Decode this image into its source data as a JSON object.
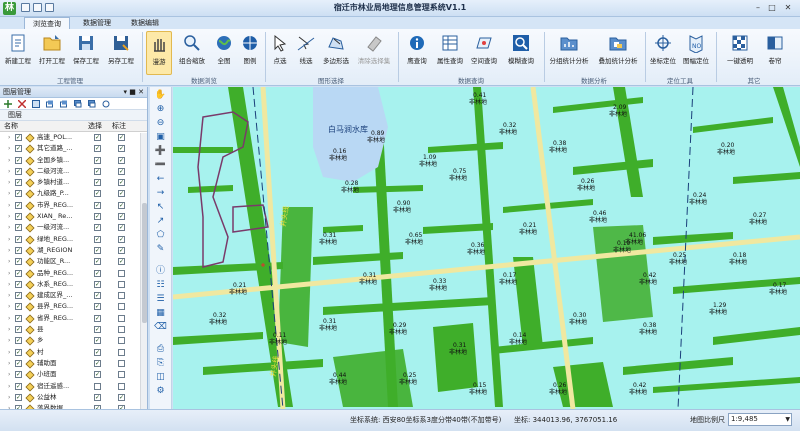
{
  "window": {
    "title": "宿迁市林业局地理信息管理系统V1.1"
  },
  "tabs": [
    {
      "label": "浏览查询",
      "active": true
    },
    {
      "label": "数据管理",
      "active": false
    },
    {
      "label": "数据编辑",
      "active": false
    }
  ],
  "ribbon": {
    "groups": [
      {
        "label": "工程管理",
        "buttons": [
          "新建工程",
          "打开工程",
          "保存工程",
          "另存工程"
        ]
      },
      {
        "label": "数据浏览",
        "buttons": [
          "漫游",
          "组合缩放",
          "全图",
          "图例"
        ]
      },
      {
        "label": "图形选择",
        "buttons": [
          "点选",
          "线选",
          "多边形选",
          "清除选择集"
        ]
      },
      {
        "label": "数据查询",
        "buttons": [
          "鹰查询",
          "属性查询",
          "空间查询",
          "模糊查询"
        ]
      },
      {
        "label": "数据分析",
        "buttons": [
          "分组统计分析",
          "叠加统计分析"
        ]
      },
      {
        "label": "定位工具",
        "buttons": [
          "坐标定位",
          "图幅定位"
        ]
      },
      {
        "label": "其它",
        "buttons": [
          "一键透明",
          "卷帘"
        ]
      }
    ]
  },
  "left_panel": {
    "title": "图层管理",
    "tab": "图层",
    "columns": {
      "name": "名称",
      "select": "选择",
      "label": "标注"
    },
    "layers": [
      {
        "name": "高速_POL...",
        "visible": true,
        "select": true,
        "label": true
      },
      {
        "name": "其它道路_...",
        "visible": true,
        "select": true,
        "label": true
      },
      {
        "name": "全国乡镇...",
        "visible": true,
        "select": true,
        "label": true
      },
      {
        "name": "二级河流...",
        "visible": true,
        "select": true,
        "label": true
      },
      {
        "name": "乡镇村道...",
        "visible": true,
        "select": true,
        "label": true
      },
      {
        "name": "九级路_P...",
        "visible": true,
        "select": true,
        "label": true
      },
      {
        "name": "市界_REG...",
        "visible": true,
        "select": true,
        "label": true
      },
      {
        "name": "XIAN_ Re...",
        "visible": true,
        "select": true,
        "label": true
      },
      {
        "name": "一级河流...",
        "visible": true,
        "select": true,
        "label": true
      },
      {
        "name": "绿地_REG...",
        "visible": true,
        "select": true,
        "label": true
      },
      {
        "name": "湖_REGION",
        "visible": true,
        "select": true,
        "label": true
      },
      {
        "name": "功能区_R...",
        "visible": true,
        "select": true,
        "label": true
      },
      {
        "name": "品种_REG...",
        "visible": true,
        "select": true,
        "label": false
      },
      {
        "name": "水系_REG...",
        "visible": true,
        "select": true,
        "label": false
      },
      {
        "name": "建成区界_...",
        "visible": true,
        "select": true,
        "label": false
      },
      {
        "name": "县界_REG...",
        "visible": true,
        "select": true,
        "label": false
      },
      {
        "name": "省界_REG...",
        "visible": true,
        "select": true,
        "label": false
      },
      {
        "name": "县",
        "visible": true,
        "select": true,
        "label": false
      },
      {
        "name": "乡",
        "visible": true,
        "select": true,
        "label": false
      },
      {
        "name": "村",
        "visible": true,
        "select": true,
        "label": false
      },
      {
        "name": "辅助面",
        "visible": true,
        "select": true,
        "label": false
      },
      {
        "name": "小班面",
        "visible": true,
        "select": true,
        "label": false
      },
      {
        "name": "宿迁遥感...",
        "visible": true,
        "select": false,
        "label": false
      },
      {
        "name": "公益林",
        "visible": true,
        "select": true,
        "label": true
      },
      {
        "name": "落界数据...",
        "visible": true,
        "select": true,
        "label": true
      }
    ]
  },
  "map": {
    "lake_label": "白马涧水库",
    "road_labels": [
      "井头线",
      "井头线"
    ],
    "parcel_labels": [
      {
        "value": "0.89",
        "type": "非林地"
      },
      {
        "value": "0.41",
        "type": "非林地"
      },
      {
        "value": "2.09",
        "type": "非林地"
      },
      {
        "value": "0.16",
        "type": "非林地"
      },
      {
        "value": "0.28",
        "type": "非林地"
      },
      {
        "value": "0.90",
        "type": "非林地"
      },
      {
        "value": "1.09",
        "type": "非林地"
      },
      {
        "value": "0.75",
        "type": "非林地"
      },
      {
        "value": "0.32",
        "type": "非林地"
      },
      {
        "value": "0.38",
        "type": "非林地"
      },
      {
        "value": "0.26",
        "type": "非林地"
      },
      {
        "value": "0.46",
        "type": "非林地"
      },
      {
        "value": "0.21",
        "type": "非林地"
      },
      {
        "value": "0.36",
        "type": "非林地"
      },
      {
        "value": "0.65",
        "type": "非林地"
      },
      {
        "value": "0.31",
        "type": "非林地"
      },
      {
        "value": "0.31",
        "type": "非林地"
      },
      {
        "value": "0.33",
        "type": "非林地"
      },
      {
        "value": "0.17",
        "type": "非林地"
      },
      {
        "value": "0.10",
        "type": "非林地"
      },
      {
        "value": "0.42",
        "type": "非林地"
      },
      {
        "value": "0.25",
        "type": "非林地"
      },
      {
        "value": "0.24",
        "type": "非林地"
      },
      {
        "value": "0.20",
        "type": "非林地"
      },
      {
        "value": "41.06",
        "type": "非林地"
      },
      {
        "value": "0.18",
        "type": "非林地"
      },
      {
        "value": "0.27",
        "type": "非林地"
      },
      {
        "value": "0.17",
        "type": "非林地"
      },
      {
        "value": "1.29",
        "type": "非林地"
      },
      {
        "value": "0.38",
        "type": "非林地"
      },
      {
        "value": "0.30",
        "type": "非林地"
      },
      {
        "value": "0.14",
        "type": "非林地"
      },
      {
        "value": "0.31",
        "type": "非林地"
      },
      {
        "value": "0.29",
        "type": "非林地"
      },
      {
        "value": "0.31",
        "type": "非林地"
      },
      {
        "value": "0.21",
        "type": "非林地"
      },
      {
        "value": "0.32",
        "type": "非林地"
      },
      {
        "value": "0.11",
        "type": "非林地"
      },
      {
        "value": "0.44",
        "type": "非林地"
      },
      {
        "value": "0.25",
        "type": "非林地"
      },
      {
        "value": "0.15",
        "type": "非林地"
      },
      {
        "value": "0.26",
        "type": "非林地"
      },
      {
        "value": "0.42",
        "type": "非林地"
      }
    ],
    "colors": {
      "background": "#a7f2ee",
      "green_strip": "#3fae2a",
      "lake": "#b9d8f4",
      "road": "#f0e8a0",
      "boundary": "#7a3a6a"
    }
  },
  "status": {
    "coord_system": "坐标系统: 西安80坐标系3度分带40带(不加带号)",
    "coords": "坐标: 344013.96, 3767051.16",
    "scale_label": "地图比例尺",
    "scale_value": "1:9,485"
  }
}
